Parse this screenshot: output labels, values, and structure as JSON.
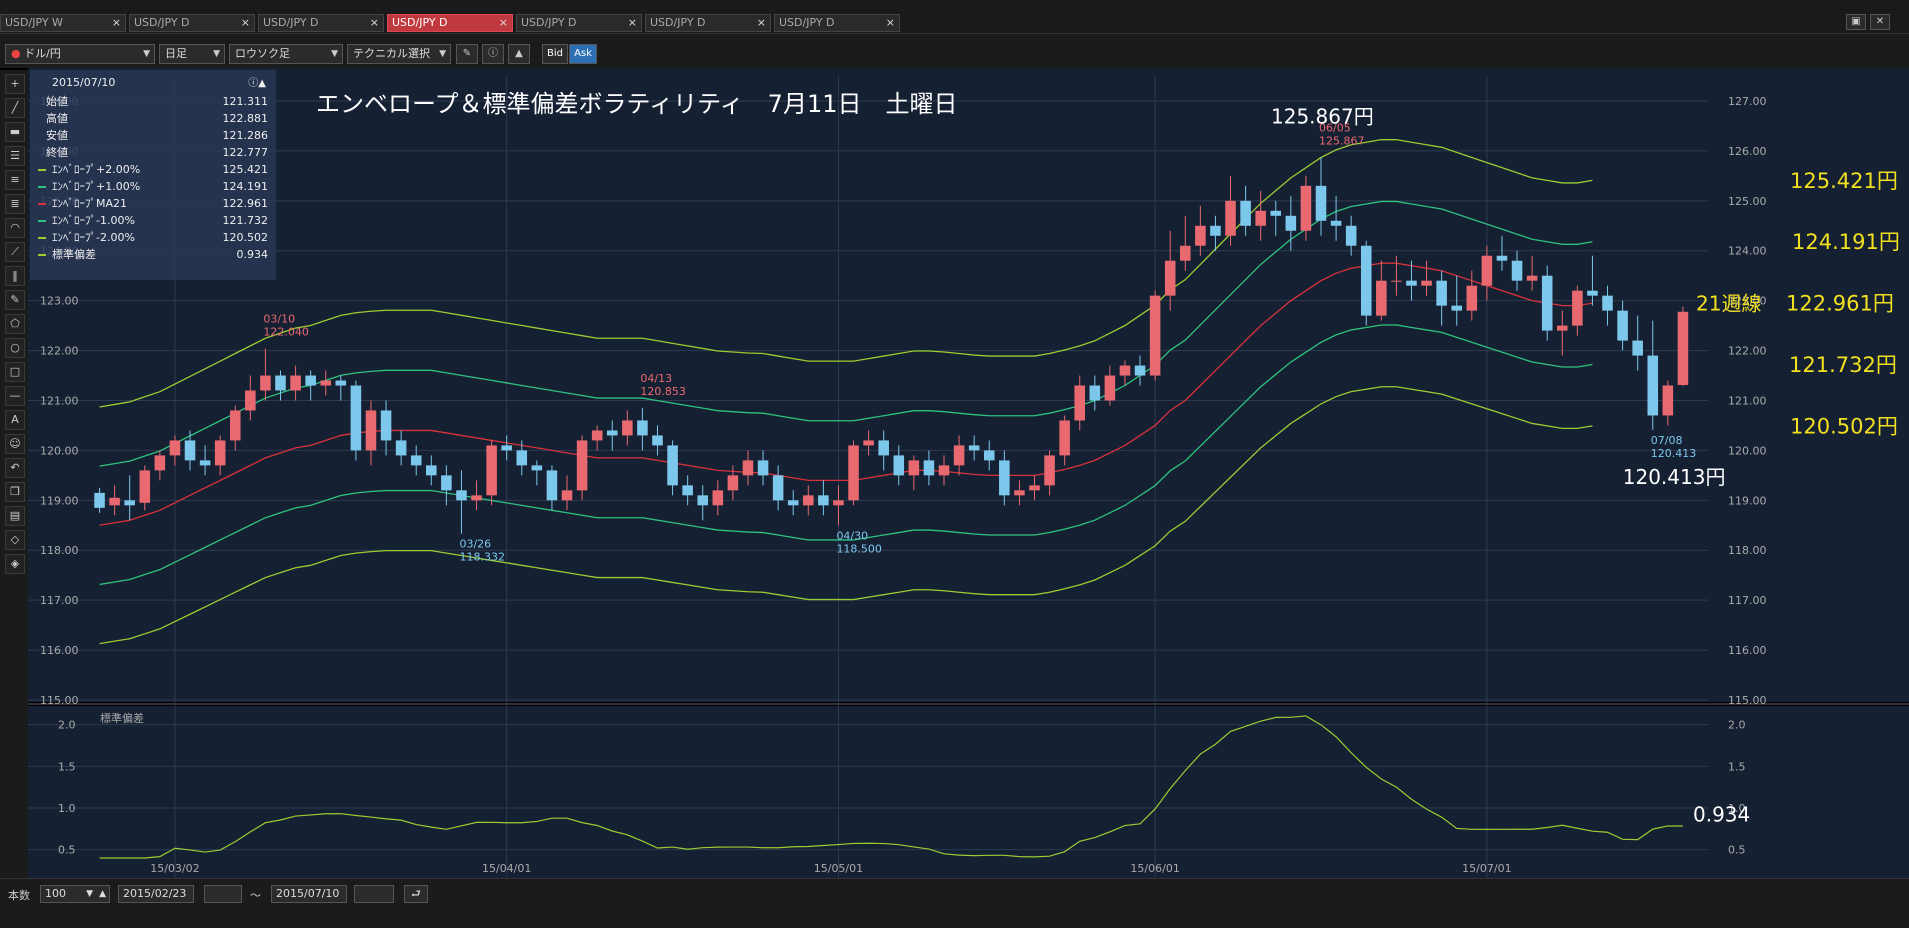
{
  "tabs": [
    {
      "label": "USD/JPY W",
      "active": false
    },
    {
      "label": "USD/JPY D",
      "active": false
    },
    {
      "label": "USD/JPY D",
      "active": false
    },
    {
      "label": "USD/JPY D",
      "active": true
    },
    {
      "label": "USD/JPY D",
      "active": false
    },
    {
      "label": "USD/JPY D",
      "active": false
    },
    {
      "label": "USD/JPY D",
      "active": false
    }
  ],
  "tab_close": "×",
  "toolbar": {
    "pair": "ドル/円",
    "timeframe": "日足",
    "chart_type": "ロウソク足",
    "technical": "テクニカル選択",
    "bid": "Bid",
    "ask": "Ask"
  },
  "legend": {
    "date": "2015/07/10",
    "rows": [
      {
        "label": "始値",
        "value": "121.311",
        "color": ""
      },
      {
        "label": "高値",
        "value": "122.881",
        "color": ""
      },
      {
        "label": "安値",
        "value": "121.286",
        "color": ""
      },
      {
        "label": "終値",
        "value": "122.777",
        "color": ""
      },
      {
        "label": "ｴﾝﾍﾞﾛｰﾌﾟ+2.00%",
        "value": "125.421",
        "color": "#9acd32"
      },
      {
        "label": "ｴﾝﾍﾞﾛｰﾌﾟ+1.00%",
        "value": "124.191",
        "color": "#2ec27e"
      },
      {
        "label": "ｴﾝﾍﾞﾛｰﾌﾟMA21",
        "value": "122.961",
        "color": "#d8323c"
      },
      {
        "label": "ｴﾝﾍﾞﾛｰﾌﾟ-1.00%",
        "value": "121.732",
        "color": "#2ec27e"
      },
      {
        "label": "ｴﾝﾍﾞﾛｰﾌﾟ-2.00%",
        "value": "120.502",
        "color": "#9acd32"
      },
      {
        "label": "標準偏差",
        "value": "0.934",
        "color": "#9acd32"
      }
    ]
  },
  "bottom": {
    "count_label": "本数",
    "count": "100",
    "from": "2015/02/23",
    "tilde": "～",
    "to": "2015/07/10"
  },
  "chart_data": {
    "type": "candlestick",
    "title": "エンベロープ＆標準偏差ボラティリティ　7月11日　土曜日",
    "y_ticks": [
      "127.00",
      "126.00",
      "125.00",
      "124.00",
      "123.00",
      "122.00",
      "121.00",
      "120.00",
      "119.00",
      "118.00",
      "117.00",
      "116.00",
      "115.00"
    ],
    "ylim": [
      115.0,
      127.3
    ],
    "x_ticks": [
      {
        "label": "15/03/02",
        "index": 5
      },
      {
        "label": "15/04/01",
        "index": 27
      },
      {
        "label": "15/05/01",
        "index": 49
      },
      {
        "label": "15/06/01",
        "index": 70
      },
      {
        "label": "15/07/01",
        "index": 92
      }
    ],
    "n": 100,
    "candles": [
      [
        119.15,
        118.85,
        119.25,
        118.75
      ],
      [
        118.9,
        119.05,
        119.3,
        118.7
      ],
      [
        119.0,
        118.9,
        119.5,
        118.6
      ],
      [
        118.95,
        119.6,
        119.7,
        118.8
      ],
      [
        119.6,
        119.9,
        120.0,
        119.4
      ],
      [
        119.9,
        120.2,
        120.3,
        119.7
      ],
      [
        120.2,
        119.8,
        120.4,
        119.6
      ],
      [
        119.8,
        119.7,
        120.1,
        119.5
      ],
      [
        119.7,
        120.2,
        120.3,
        119.5
      ],
      [
        120.2,
        120.8,
        120.9,
        120.0
      ],
      [
        120.8,
        121.2,
        121.5,
        120.6
      ],
      [
        121.2,
        121.5,
        122.04,
        121.0
      ],
      [
        121.5,
        121.2,
        121.6,
        121.0
      ],
      [
        121.2,
        121.5,
        121.7,
        121.0
      ],
      [
        121.5,
        121.3,
        121.6,
        121.0
      ],
      [
        121.3,
        121.4,
        121.6,
        121.1
      ],
      [
        121.4,
        121.3,
        121.5,
        121.0
      ],
      [
        121.3,
        120.0,
        121.4,
        119.8
      ],
      [
        120.0,
        120.8,
        121.0,
        119.7
      ],
      [
        120.8,
        120.2,
        121.0,
        119.9
      ],
      [
        120.2,
        119.9,
        120.4,
        119.7
      ],
      [
        119.9,
        119.7,
        120.1,
        119.5
      ],
      [
        119.7,
        119.5,
        119.9,
        119.3
      ],
      [
        119.5,
        119.2,
        119.7,
        118.9
      ],
      [
        119.2,
        119.0,
        119.6,
        118.332
      ],
      [
        119.0,
        119.1,
        119.4,
        118.8
      ],
      [
        119.1,
        120.1,
        120.2,
        118.9
      ],
      [
        120.1,
        120.0,
        120.3,
        119.8
      ],
      [
        120.0,
        119.7,
        120.2,
        119.5
      ],
      [
        119.7,
        119.6,
        119.8,
        119.3
      ],
      [
        119.6,
        119.0,
        119.7,
        118.8
      ],
      [
        119.0,
        119.2,
        119.5,
        118.8
      ],
      [
        119.2,
        120.2,
        120.3,
        119.0
      ],
      [
        120.2,
        120.4,
        120.5,
        120.0
      ],
      [
        120.4,
        120.3,
        120.6,
        120.0
      ],
      [
        120.3,
        120.6,
        120.8,
        120.1
      ],
      [
        120.6,
        120.3,
        120.853,
        120.0
      ],
      [
        120.3,
        120.1,
        120.5,
        119.9
      ],
      [
        120.1,
        119.3,
        120.2,
        119.1
      ],
      [
        119.3,
        119.1,
        119.5,
        118.9
      ],
      [
        119.1,
        118.9,
        119.3,
        118.6
      ],
      [
        118.9,
        119.2,
        119.4,
        118.7
      ],
      [
        119.2,
        119.5,
        119.7,
        119.0
      ],
      [
        119.5,
        119.8,
        120.0,
        119.3
      ],
      [
        119.8,
        119.5,
        120.0,
        119.3
      ],
      [
        119.5,
        119.0,
        119.7,
        118.8
      ],
      [
        119.0,
        118.9,
        119.2,
        118.7
      ],
      [
        118.9,
        119.1,
        119.3,
        118.7
      ],
      [
        119.1,
        118.9,
        119.4,
        118.7
      ],
      [
        118.9,
        119.0,
        119.3,
        118.5
      ],
      [
        119.0,
        120.1,
        120.2,
        118.9
      ],
      [
        120.1,
        120.2,
        120.4,
        119.9
      ],
      [
        120.2,
        119.9,
        120.4,
        119.6
      ],
      [
        119.9,
        119.5,
        120.1,
        119.3
      ],
      [
        119.5,
        119.8,
        119.9,
        119.2
      ],
      [
        119.8,
        119.5,
        120.0,
        119.3
      ],
      [
        119.5,
        119.7,
        119.9,
        119.3
      ],
      [
        119.7,
        120.1,
        120.3,
        119.5
      ],
      [
        120.1,
        120.0,
        120.3,
        119.8
      ],
      [
        120.0,
        119.8,
        120.2,
        119.6
      ],
      [
        119.8,
        119.1,
        120.0,
        118.9
      ],
      [
        119.1,
        119.2,
        119.4,
        118.9
      ],
      [
        119.2,
        119.3,
        119.5,
        119.0
      ],
      [
        119.3,
        119.9,
        120.0,
        119.1
      ],
      [
        119.9,
        120.6,
        120.7,
        119.7
      ],
      [
        120.6,
        121.3,
        121.5,
        120.4
      ],
      [
        121.3,
        121.0,
        121.5,
        120.8
      ],
      [
        121.0,
        121.5,
        121.7,
        120.9
      ],
      [
        121.5,
        121.7,
        121.8,
        121.3
      ],
      [
        121.7,
        121.5,
        121.9,
        121.3
      ],
      [
        121.5,
        123.1,
        123.2,
        121.4
      ],
      [
        123.1,
        123.8,
        124.4,
        122.8
      ],
      [
        123.8,
        124.1,
        124.7,
        123.6
      ],
      [
        124.1,
        124.5,
        124.9,
        123.9
      ],
      [
        124.5,
        124.3,
        124.7,
        124.0
      ],
      [
        124.3,
        125.0,
        125.5,
        124.1
      ],
      [
        125.0,
        124.5,
        125.3,
        124.3
      ],
      [
        124.5,
        124.8,
        125.2,
        124.2
      ],
      [
        124.8,
        124.7,
        125.0,
        124.3
      ],
      [
        124.7,
        124.4,
        125.1,
        124.0
      ],
      [
        124.4,
        125.3,
        125.5,
        124.2
      ],
      [
        125.3,
        124.6,
        125.867,
        124.3
      ],
      [
        124.6,
        124.5,
        125.1,
        124.2
      ],
      [
        124.5,
        124.1,
        124.7,
        123.9
      ],
      [
        124.1,
        122.7,
        124.2,
        122.5
      ],
      [
        122.7,
        123.4,
        123.8,
        122.6
      ],
      [
        123.4,
        123.4,
        123.9,
        123.1
      ],
      [
        123.4,
        123.3,
        123.8,
        123.0
      ],
      [
        123.3,
        123.4,
        123.8,
        123.1
      ],
      [
        123.4,
        122.9,
        123.6,
        122.5
      ],
      [
        122.9,
        122.8,
        123.5,
        122.5
      ],
      [
        122.8,
        123.3,
        123.6,
        122.6
      ],
      [
        123.3,
        123.9,
        124.1,
        123.0
      ],
      [
        123.9,
        123.8,
        124.3,
        123.6
      ],
      [
        123.8,
        123.4,
        124.0,
        123.2
      ],
      [
        123.4,
        123.5,
        123.9,
        123.2
      ],
      [
        123.5,
        122.4,
        123.7,
        122.2
      ],
      [
        122.4,
        122.5,
        122.8,
        121.9
      ],
      [
        122.5,
        123.2,
        123.3,
        122.3
      ],
      [
        123.2,
        123.1,
        123.9,
        122.9
      ]
    ],
    "extra_candles": [
      [
        123.1,
        122.8,
        123.3,
        122.5
      ],
      [
        122.8,
        122.2,
        123.0,
        122.0
      ],
      [
        122.2,
        121.9,
        122.7,
        121.6
      ],
      [
        121.9,
        120.7,
        122.6,
        120.413
      ],
      [
        120.7,
        121.3,
        121.4,
        120.5
      ],
      [
        121.311,
        122.777,
        122.881,
        121.286
      ]
    ],
    "envelope": {
      "ma": [
        118.5,
        118.55,
        118.6,
        118.7,
        118.8,
        118.95,
        119.1,
        119.25,
        119.4,
        119.55,
        119.7,
        119.85,
        119.95,
        120.05,
        120.1,
        120.2,
        120.3,
        120.35,
        120.38,
        120.4,
        120.4,
        120.4,
        120.4,
        120.35,
        120.3,
        120.25,
        120.2,
        120.15,
        120.1,
        120.05,
        120.0,
        119.95,
        119.9,
        119.85,
        119.85,
        119.85,
        119.85,
        119.8,
        119.75,
        119.7,
        119.65,
        119.6,
        119.58,
        119.56,
        119.55,
        119.5,
        119.45,
        119.4,
        119.4,
        119.4,
        119.4,
        119.45,
        119.5,
        119.55,
        119.6,
        119.6,
        119.58,
        119.55,
        119.52,
        119.5,
        119.5,
        119.5,
        119.5,
        119.55,
        119.62,
        119.7,
        119.8,
        119.95,
        120.1,
        120.3,
        120.5,
        120.8,
        121.0,
        121.3,
        121.6,
        121.9,
        122.2,
        122.5,
        122.75,
        123.0,
        123.2,
        123.4,
        123.55,
        123.65,
        123.7,
        123.75,
        123.75,
        123.7,
        123.65,
        123.6,
        123.5,
        123.4,
        123.3,
        123.2,
        123.1,
        123.0,
        122.95,
        122.9,
        122.9,
        122.95
      ]
    },
    "stddev": {
      "label": "標準偏差",
      "yticks": [
        "2.0",
        "1.5",
        "1.0",
        "0.5"
      ],
      "ylim": [
        0.4,
        2.2
      ],
      "current": "0.934"
    },
    "annotations": [
      {
        "date": "03/10",
        "price": "122.040",
        "type": "high"
      },
      {
        "date": "04/13",
        "price": "120.853",
        "type": "high"
      },
      {
        "date": "06/05",
        "price": "125.867",
        "type": "high"
      },
      {
        "date": "03/26",
        "price": "118.332",
        "type": "low"
      },
      {
        "date": "04/30",
        "price": "118.500",
        "type": "low"
      },
      {
        "date": "07/08",
        "price": "120.413",
        "type": "low"
      }
    ],
    "overlay_labels": {
      "high": "125.867円",
      "low": "120.413円",
      "env_p2": "125.421円",
      "env_p1": "124.191円",
      "ma_label": "21週線",
      "ma": "122.961円",
      "env_m1": "121.732円",
      "env_m2": "120.502円",
      "stddev": "0.934"
    },
    "colors": {
      "up": "#e8696f",
      "down": "#7cc8ec",
      "ma": "#d8323c",
      "env1": "#2ec27e",
      "env2": "#9acd32",
      "bg": "#162033"
    }
  }
}
